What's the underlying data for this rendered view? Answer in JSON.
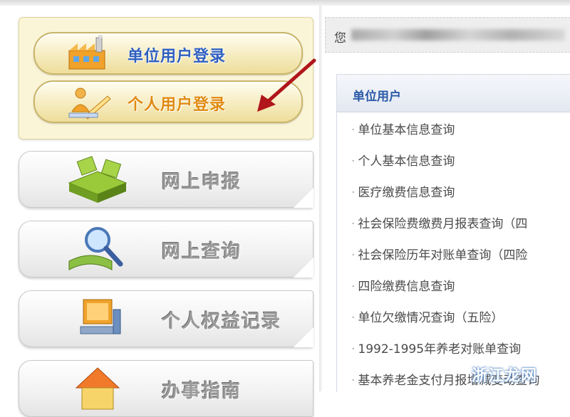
{
  "login": {
    "unit_label": "单位用户登录",
    "personal_label": "个人用户登录"
  },
  "features": [
    {
      "label": "网上申报",
      "icon": "cubes-icon"
    },
    {
      "label": "网上查询",
      "icon": "magnifier-book-icon"
    },
    {
      "label": "个人权益记录",
      "icon": "computer-icon"
    },
    {
      "label": "办事指南",
      "icon": "house-icon"
    }
  ],
  "greeting": {
    "text": "您"
  },
  "panel": {
    "title": "单位用户",
    "items": [
      "单位基本信息查询",
      "个人基本信息查询",
      "医疗缴费信息查询",
      "社会保险费缴费月报表查询（四",
      "社会保险历年对账单查询（四险",
      "四险缴费信息查询",
      "单位欠缴情况查询（五险）",
      "1992-1995年养老对账单查询",
      "基本养老金支付月报增减变动查询"
    ]
  },
  "watermark": "浙江龙网",
  "colors": {
    "accent_blue": "#2b5aa8",
    "accent_orange": "#e08a10",
    "arrow_red": "#b0161b"
  }
}
